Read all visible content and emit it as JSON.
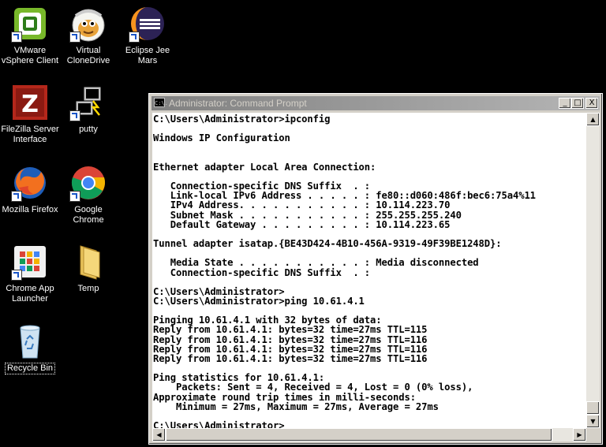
{
  "desktop": {
    "icons": [
      {
        "line1": "VMware",
        "line2": "vSphere Client",
        "icon": "vmware-icon"
      },
      {
        "line1": "Virtual",
        "line2": "CloneDrive",
        "icon": "clonedrive-icon"
      },
      {
        "line1": "Eclipse Jee",
        "line2": "Mars",
        "icon": "eclipse-icon"
      },
      {
        "line1": "FileZilla Server",
        "line2": "Interface",
        "icon": "filezilla-icon"
      },
      {
        "line1": "putty",
        "line2": "",
        "icon": "putty-icon"
      },
      {
        "line1": "Mozilla Firefox",
        "line2": "",
        "icon": "firefox-icon"
      },
      {
        "line1": "Google",
        "line2": "Chrome",
        "icon": "chrome-icon"
      },
      {
        "line1": "Chrome App",
        "line2": "Launcher",
        "icon": "chrome-app-launcher-icon"
      },
      {
        "line1": "Temp",
        "line2": "",
        "icon": "folder-icon"
      },
      {
        "line1": "Recycle Bin",
        "line2": "",
        "icon": "recycle-bin-icon"
      }
    ]
  },
  "window": {
    "title": "Administrator: Command Prompt",
    "icon_text": "C:\\.",
    "minimize": "_",
    "maximize": "□",
    "close": "X",
    "console_lines": [
      "C:\\Users\\Administrator>ipconfig",
      "",
      "Windows IP Configuration",
      "",
      "",
      "Ethernet adapter Local Area Connection:",
      "",
      "   Connection-specific DNS Suffix  . :",
      "   Link-local IPv6 Address . . . . . : fe80::d060:486f:bec6:75a4%11",
      "   IPv4 Address. . . . . . . . . . . : 10.114.223.70",
      "   Subnet Mask . . . . . . . . . . . : 255.255.255.240",
      "   Default Gateway . . . . . . . . . : 10.114.223.65",
      "",
      "Tunnel adapter isatap.{BE43D424-4B10-456A-9319-49F39BE1248D}:",
      "",
      "   Media State . . . . . . . . . . . : Media disconnected",
      "   Connection-specific DNS Suffix  . :",
      "",
      "C:\\Users\\Administrator>",
      "C:\\Users\\Administrator>ping 10.61.4.1",
      "",
      "Pinging 10.61.4.1 with 32 bytes of data:",
      "Reply from 10.61.4.1: bytes=32 time=27ms TTL=115",
      "Reply from 10.61.4.1: bytes=32 time=27ms TTL=116",
      "Reply from 10.61.4.1: bytes=32 time=27ms TTL=116",
      "Reply from 10.61.4.1: bytes=32 time=27ms TTL=116",
      "",
      "Ping statistics for 10.61.4.1:",
      "    Packets: Sent = 4, Received = 4, Lost = 0 (0% loss),",
      "Approximate round trip times in milli-seconds:",
      "    Minimum = 27ms, Maximum = 27ms, Average = 27ms",
      "",
      "C:\\Users\\Administrator>"
    ],
    "scroll_up": "▲",
    "scroll_down": "▼",
    "scroll_left": "◀",
    "scroll_right": "▶"
  },
  "colors": {
    "desktop_bg": "#000000",
    "console_bg": "#ffffff",
    "console_text": "#000000",
    "titlebar_inactive": "#808080"
  }
}
